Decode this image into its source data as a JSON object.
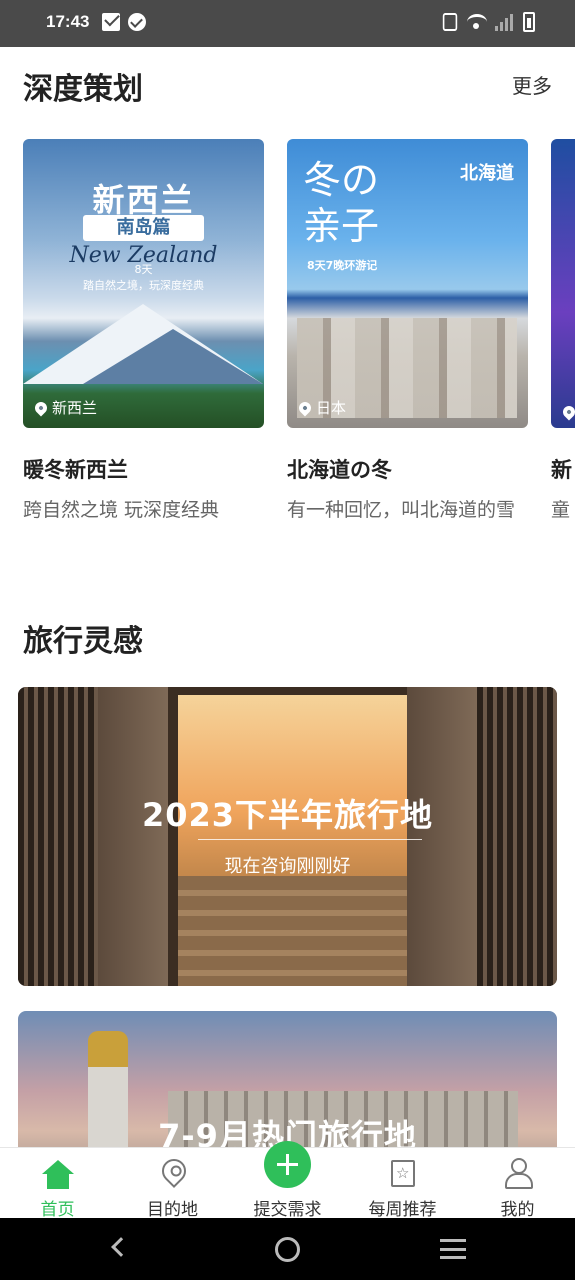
{
  "status_bar": {
    "time": "17:43"
  },
  "section_featured": {
    "title": "深度策划",
    "more_label": "更多",
    "cards": [
      {
        "image_title": "新西兰",
        "image_badge": "南岛篇",
        "image_script": "New Zealand",
        "image_line1": "8天",
        "image_line2": "踏自然之境，玩深度经典",
        "location": "新西兰",
        "title": "暖冬新西兰",
        "desc": "跨自然之境 玩深度经典"
      },
      {
        "image_title": "冬の\n亲子",
        "image_tag": "北海道",
        "image_sub": "8天7晚环游记",
        "location": "日本",
        "title": "北海道の冬",
        "desc": "有一种回忆，叫北海道的雪"
      },
      {
        "title": "新",
        "desc": "童"
      }
    ]
  },
  "section_inspiration": {
    "title": "旅行灵感",
    "banners": [
      {
        "title": "2023下半年旅行地",
        "subtitle": "现在咨询刚刚好"
      },
      {
        "title": "7-9月热门旅行地"
      }
    ]
  },
  "bottom_nav": {
    "items": [
      {
        "label": "首页",
        "icon": "home-icon",
        "active": true
      },
      {
        "label": "目的地",
        "icon": "location-icon"
      },
      {
        "label": "提交需求",
        "icon": "plus-icon"
      },
      {
        "label": "每周推荐",
        "icon": "star-icon"
      },
      {
        "label": "我的",
        "icon": "user-icon"
      }
    ]
  },
  "colors": {
    "accent": "#2fbf5a",
    "status_bar": "#4a4a4a",
    "system_nav": "#000000"
  }
}
